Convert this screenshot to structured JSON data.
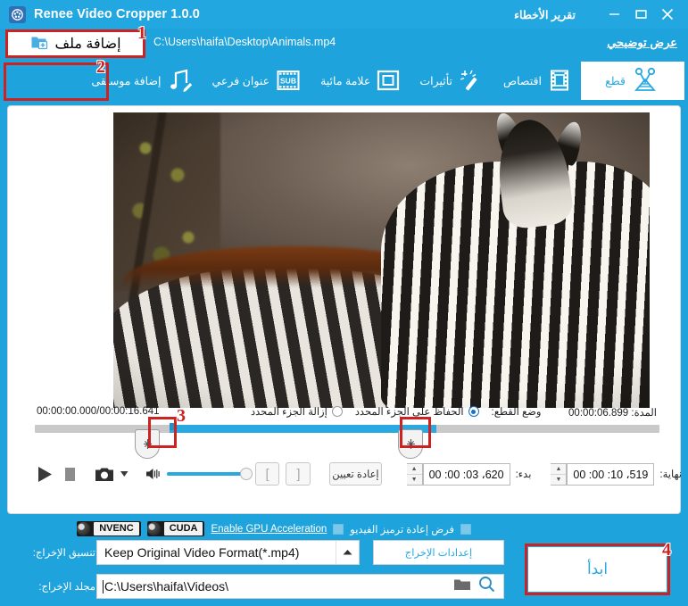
{
  "window": {
    "title": "Renee Video Cropper 1.0.0",
    "bug_report": "تقرير الأخطاء",
    "minimize": "minimize",
    "maximize": "maximize",
    "close": "close"
  },
  "addfile": {
    "label": "إضافة ملف",
    "file_path": "C:\\Users\\haifa\\Desktop\\Animals.mp4",
    "demo_link": "عرض توضيحي"
  },
  "callouts": {
    "one": "1",
    "two": "2",
    "three": "3",
    "four": "4"
  },
  "toolbar": {
    "tabs": [
      {
        "label": "قطع",
        "icon": "scissors-icon",
        "active": true
      },
      {
        "label": "اقتصاص",
        "icon": "film-crop-icon",
        "active": false
      },
      {
        "label": "تأثيرات",
        "icon": "magic-wand-icon",
        "active": false
      },
      {
        "label": "علامة مائية",
        "icon": "watermark-icon",
        "active": false
      },
      {
        "label": "عنوان فرعي",
        "icon": "subtitle-icon",
        "active": false
      },
      {
        "label": "إضافة موسيقى",
        "icon": "music-note-icon",
        "active": false
      }
    ]
  },
  "player": {
    "current_time": "00:00:00.000",
    "total_time": "00:00:16.641",
    "time_separator": "/",
    "duration_label": "المدة:",
    "duration_value": "00:00:06.899",
    "cut_mode_label": "وضع القطع:",
    "keep_selected_label": "الحفاظ على الجزء المحدد",
    "remove_selected_label": "إزالة الجزء المحدد",
    "cut_mode_selected": "keep"
  },
  "controls": {
    "play": "play-button",
    "stop": "stop-button",
    "snapshot": "snapshot-button",
    "snapshot_dropdown": "snapshot-dropdown",
    "volume": "volume-icon",
    "volume_percent": 88,
    "bracket_start": "[",
    "bracket_end": "]",
    "reset_label": "إعادة تعيين",
    "start_label": "بدء:",
    "start_value": "00 :00 :03 ،620",
    "end_label": "نهاية:",
    "end_value": "00 :00 :10 ،519"
  },
  "bottom": {
    "force_reencode_label": "فرض إعادة ترميز الفيديو",
    "force_reencode_checked": false,
    "gpu_label": "Enable GPU Acceleration",
    "gpu_checked": false,
    "cuda_badge": "CUDA",
    "nvenc_badge": "NVENC",
    "format_label": "تنسيق الإخراج:",
    "format_value": "Keep Original Video Format(*.mp4)",
    "output_settings_label": "إعدادات الإخراج",
    "folder_label": "مجلد الإخراج:",
    "folder_value": "C:\\Users\\haifa\\Videos\\",
    "browse_icon": "folder-icon",
    "search_icon": "search-icon",
    "start_button_label": "ابدأ"
  },
  "colors": {
    "brand_blue": "#22a7e0",
    "accent_blue": "#29a9e1",
    "callout_red": "#cc2222",
    "white": "#ffffff"
  }
}
